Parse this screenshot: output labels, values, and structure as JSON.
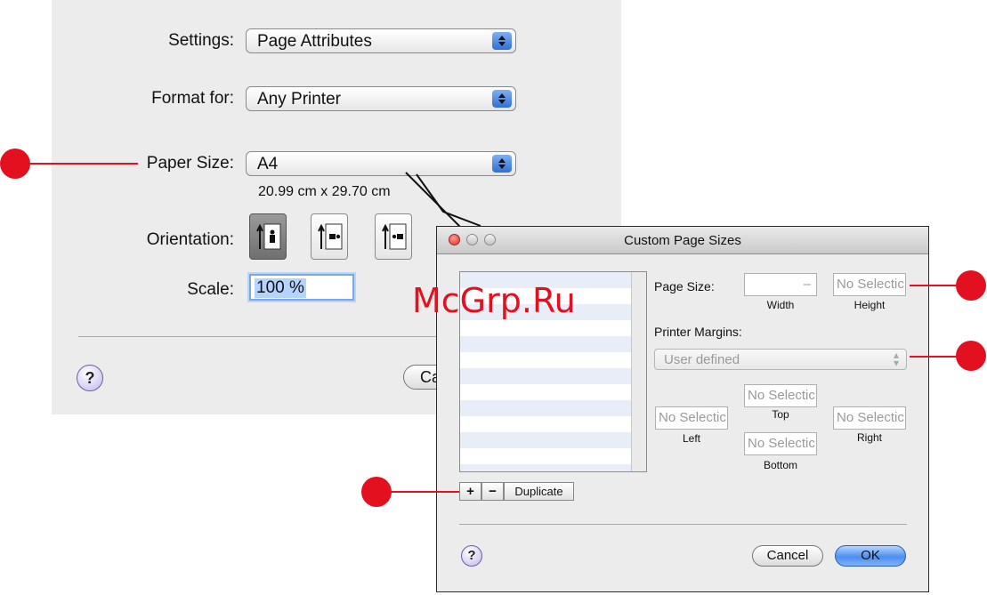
{
  "page_setup": {
    "settings_label": "Settings:",
    "settings_value": "Page Attributes",
    "format_label": "Format for:",
    "format_value": "Any Printer",
    "paper_label": "Paper Size:",
    "paper_value": "A4",
    "paper_dims": "20.99 cm x 29.70 cm",
    "orientation_label": "Orientation:",
    "scale_label": "Scale:",
    "scale_value": "100 %",
    "help": "?",
    "cancel_partial": "Ca"
  },
  "custom_window": {
    "title": "Custom Page Sizes",
    "page_size_label": "Page Size:",
    "width_value": "–",
    "height_value": "No Selectic",
    "width_caption": "Width",
    "height_caption": "Height",
    "printer_margins_label": "Printer Margins:",
    "margins_value": "User defined",
    "top_value": "No Selectic",
    "left_value": "No Selectic",
    "right_value": "No Selectic",
    "bottom_value": "No Selectic",
    "top_caption": "Top",
    "left_caption": "Left",
    "right_caption": "Right",
    "bottom_caption": "Bottom",
    "add": "+",
    "remove": "−",
    "duplicate": "Duplicate",
    "help": "?",
    "cancel": "Cancel",
    "ok": "OK"
  },
  "watermark": "McGrp.Ru",
  "colors": {
    "callout": "#e3101f",
    "accent": "#2f6fd6"
  },
  "icons": [
    "updown-arrows-icon",
    "portrait-icon",
    "landscape-left-icon",
    "landscape-right-icon",
    "help-icon"
  ]
}
